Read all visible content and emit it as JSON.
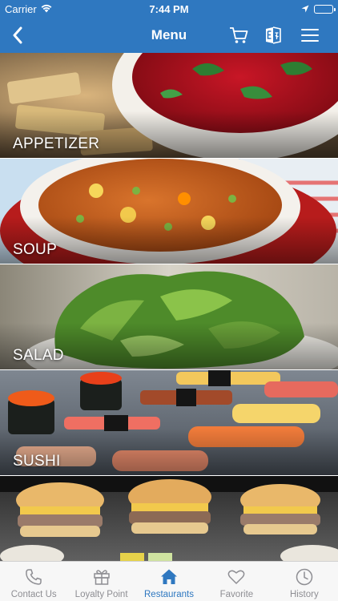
{
  "status": {
    "carrier": "Carrier",
    "time": "7:44 PM"
  },
  "nav": {
    "title": "Menu"
  },
  "categories": [
    {
      "label": "APPETIZER"
    },
    {
      "label": "SOUP"
    },
    {
      "label": "SALAD"
    },
    {
      "label": "SUSHI"
    },
    {
      "label": ""
    }
  ],
  "tabs": [
    {
      "label": "Contact Us",
      "icon": "phone-icon"
    },
    {
      "label": "Loyalty Point",
      "icon": "gift-icon"
    },
    {
      "label": "Restaurants",
      "icon": "home-icon"
    },
    {
      "label": "Favorite",
      "icon": "heart-icon"
    },
    {
      "label": "History",
      "icon": "clock-icon"
    }
  ],
  "colors": {
    "brand": "#2f78c0",
    "tab_inactive": "#8e8e93",
    "tab_active": "#2f78c0"
  }
}
